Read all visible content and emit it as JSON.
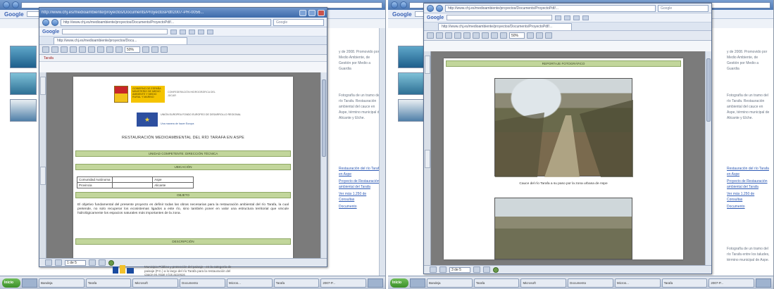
{
  "left": {
    "browser": {
      "title": "http://www.chj.es/medioambiente/proyectos/Documents/ProyectosPdf/2007-PR-0056...",
      "address": "http://www.chj.es/medioambiente/proyectos/Documents/ProyectoPdf/...",
      "search_placeholder": "Google",
      "tab_label": "http://www.chj.es/medioambiente/proyectos/Docu..."
    },
    "back": {
      "address_hint": "Google",
      "side_text_top": "y de 2008. Promovido por Medio Ambiente, de Gestión por Medio a Guardia",
      "side_text_mid": "Fotografía de un tramo del río Tarafa. Restauración ambiental del cauce en Aspe, término municipal de Alicante y Elche.",
      "links": [
        "Restauración del río Tarafa en Aspe",
        "Proyecto de Restauración ambiental del Tarafa",
        "Ver más 1.250 de Consultas",
        "Documento"
      ]
    },
    "pdf": {
      "zoom": "50%",
      "subtoolbar": "Tarafa",
      "page_field": "1 de 5",
      "ministry_name": "GOBIERNO DE ESPAÑA   MINISTERIO DE MEDIO AMBIENTE Y MEDIO RURAL Y MARINO",
      "agency": "CONFEDERACIÓN HIDROGRÁFICA DEL JÚCAR",
      "eu_fund": "UNIÓN EUROPEA  FONDO EUROPEO DE DESARROLLO REGIONAL",
      "eu_motto": "Una manera de hacer Europa",
      "title": "RESTAURACIÓN MEDIOAMBIENTAL DEL RÍO TARAFA EN ASPE",
      "band_unit": "UNIDAD COMPETENTE: DIRECCIÓN TÉCNICA",
      "band_location": "UBICACIÓN",
      "table": [
        [
          "Comunidad Autónoma",
          "",
          "Aspe"
        ],
        [
          "Provincia",
          "",
          "Alicante"
        ]
      ],
      "band_objective": "OBJETO",
      "objective": "El objetivo fundamental del presente proyecto es definir todas las obras necesarias para la restauración ambiental del río Tarafa, la cual pretende, no solo recuperar los ecosistemas ligados a este río, sino también poner en valor una estructura territorial que vincule hidrológicamente los espacios naturales más importantes de la zona.",
      "band_description": "DESCRIPCIÓN"
    },
    "footer_caption": "Municipio Público y protección del paisaje - en la categoría de paisaje (P.C.) a lo largo del río Tarafa para la restauración del cauce en Aspe y los accesos"
  },
  "right": {
    "browser": {
      "address": "http://www.chj.es/medioambiente/proyectos/Documents/ProyectoPdf/...",
      "search_placeholder": "Google"
    },
    "back": {
      "side_text_top": "y de 2008. Promovido por Medio Ambiente, de Gestión por Medio a Guardia",
      "side_text_mid": "Fotografía de un tramo del río Tarafa. Restauración ambiental del cauce en Aspe, término municipal de Alicante y Elche.",
      "links": [
        "Restauración del río Tarafa en Aspe",
        "Proyecto de Restauración ambiental del Tarafa",
        "Ver más 1.250 de Consultas",
        "Documento"
      ],
      "bottom_text": "Fotografía de un tramo del río Tarafa entre los taludes, término municipal de Aspe."
    },
    "pdf": {
      "zoom": "50%",
      "page_field": "3 de 5",
      "report_band": "REPORTAJE FOTOGRÁFICO",
      "photo_caption": "Cauce del río Tarafa a su paso por la zona urbana de Aspe"
    }
  },
  "taskbar": {
    "start": "Inicio",
    "items": [
      "Bandeja",
      "Tarafa",
      "Microsoft",
      "Documento",
      "Micros...",
      "Tarafa",
      "2007-P..."
    ]
  }
}
